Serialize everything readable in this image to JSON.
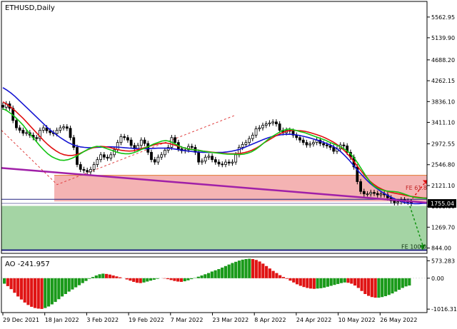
{
  "symbol_label": "ETHUSD,Daily",
  "indicator_label": "AO -241.957",
  "colors": {
    "bg": "#ffffff",
    "frame": "#000000",
    "candle": "#000000",
    "ma_fast": "#12c412",
    "ma_mid": "#e01010",
    "ma_slow": "#1414d2",
    "trendline": "#a020a8",
    "zone_red": "#f4b3b3",
    "zone_green": "#a4d4a4",
    "zone_red_line": "#e07830",
    "ao_up": "#1a9a1a",
    "ao_down": "#e01414",
    "price_box": "#000000",
    "level_line": "#202080"
  },
  "fib_labels": {
    "fe618": "FE 61.8",
    "fe100": "FE 100.0"
  },
  "chart_data": [
    {
      "type": "candlestick",
      "title": "ETHUSD,Daily",
      "x_ticks": [
        "29 Dec 2021",
        "18 Jan 2022",
        "3 Feb 2022",
        "19 Feb 2022",
        "7 Mar 2022",
        "23 Mar 2022",
        "8 Apr 2022",
        "24 Apr 2022",
        "10 May 2022",
        "26 May 2022"
      ],
      "y_ticks": [
        "5562.95",
        "5139.90",
        "4688.20",
        "4262.15",
        "3836.10",
        "3411.10",
        "2972.55",
        "2546.80",
        "2121.10",
        "1695.00",
        "1269.70",
        "844.00"
      ],
      "ylim": [
        735,
        5882
      ],
      "current_price": "1755.04",
      "close": [
        3720,
        3790,
        3700,
        3450,
        3300,
        3250,
        3190,
        3200,
        3150,
        3100,
        3080,
        3250,
        3300,
        3240,
        3200,
        3180,
        3250,
        3300,
        3320,
        3290,
        3100,
        2900,
        2550,
        2450,
        2430,
        2400,
        2450,
        2550,
        2650,
        2750,
        2700,
        2680,
        2750,
        2850,
        3000,
        3120,
        3100,
        3050,
        2940,
        2870,
        2940,
        3050,
        2980,
        2800,
        2650,
        2600,
        2700,
        2750,
        2840,
        2900,
        3100,
        3000,
        2870,
        2830,
        2850,
        2920,
        2900,
        2800,
        2600,
        2620,
        2700,
        2720,
        2650,
        2600,
        2560,
        2550,
        2600,
        2580,
        2600,
        2750,
        2900,
        2960,
        3000,
        3080,
        3150,
        3280,
        3300,
        3350,
        3380,
        3400,
        3420,
        3380,
        3250,
        3200,
        3250,
        3230,
        3150,
        3100,
        3050,
        3000,
        2950,
        2970,
        3000,
        3050,
        2980,
        2950,
        2930,
        2900,
        2820,
        2870,
        2950,
        2930,
        2800,
        2700,
        2500,
        2200,
        2000,
        1950,
        1950,
        1980,
        1960,
        1930,
        1950,
        1930,
        1870,
        1810,
        1770,
        1790,
        1830,
        1800,
        1780,
        1755
      ],
      "ma_fast": [
        3690,
        3650,
        3590,
        3520,
        3440,
        3350,
        3240,
        3140,
        3040,
        2940,
        2850,
        2770,
        2710,
        2670,
        2640,
        2635,
        2650,
        2680,
        2720,
        2770,
        2820,
        2865,
        2900,
        2920,
        2915,
        2890,
        2860,
        2830,
        2800,
        2780,
        2770,
        2770,
        2790,
        2820,
        2860,
        2890,
        2930,
        2970,
        3000,
        3030,
        3040,
        3020,
        2980,
        2940,
        2900,
        2880,
        2860,
        2850,
        2840,
        2825,
        2810,
        2800,
        2790,
        2780,
        2770,
        2762,
        2760,
        2760,
        2755,
        2760,
        2780,
        2810,
        2860,
        2920,
        2990,
        3060,
        3120,
        3170,
        3220,
        3255,
        3275,
        3265,
        3245,
        3220,
        3200,
        3170,
        3140,
        3110,
        3080,
        3050,
        3010,
        2975,
        2940,
        2905,
        2850,
        2790,
        2700,
        2580,
        2450,
        2320,
        2200,
        2110,
        2060,
        2030,
        2010,
        2000,
        1995,
        1985,
        1960,
        1930,
        1900,
        1880,
        1870,
        1865,
        1860
      ],
      "ma_mid": [
        3830,
        3780,
        3720,
        3650,
        3570,
        3490,
        3400,
        3310,
        3220,
        3130,
        3040,
        2960,
        2890,
        2830,
        2780,
        2750,
        2735,
        2735,
        2750,
        2780,
        2820,
        2860,
        2890,
        2910,
        2920,
        2915,
        2900,
        2880,
        2860,
        2840,
        2830,
        2825,
        2830,
        2850,
        2875,
        2900,
        2925,
        2950,
        2970,
        2985,
        2990,
        2975,
        2950,
        2925,
        2900,
        2880,
        2865,
        2850,
        2840,
        2825,
        2815,
        2805,
        2795,
        2785,
        2778,
        2772,
        2770,
        2770,
        2775,
        2790,
        2810,
        2840,
        2880,
        2930,
        2990,
        3040,
        3090,
        3140,
        3180,
        3215,
        3240,
        3250,
        3245,
        3240,
        3230,
        3210,
        3185,
        3160,
        3130,
        3095,
        3055,
        3010,
        2955,
        2890,
        2810,
        2720,
        2620,
        2510,
        2400,
        2300,
        2210,
        2140,
        2085,
        2045,
        2010,
        1985,
        1965,
        1950,
        1935,
        1915,
        1900,
        1890,
        1880,
        1870,
        1865
      ],
      "ma_slow": [
        4120,
        4070,
        4010,
        3940,
        3860,
        3780,
        3700,
        3620,
        3540,
        3460,
        3380,
        3300,
        3230,
        3165,
        3105,
        3050,
        3000,
        2960,
        2930,
        2910,
        2900,
        2895,
        2895,
        2900,
        2905,
        2910,
        2912,
        2910,
        2905,
        2900,
        2892,
        2885,
        2880,
        2876,
        2874,
        2874,
        2876,
        2880,
        2884,
        2886,
        2884,
        2878,
        2868,
        2855,
        2840,
        2828,
        2818,
        2810,
        2804,
        2800,
        2798,
        2796,
        2795,
        2796,
        2800,
        2808,
        2820,
        2838,
        2860,
        2890,
        2925,
        2960,
        2995,
        3030,
        3065,
        3095,
        3120,
        3140,
        3155,
        3165,
        3168,
        3165,
        3155,
        3140,
        3120,
        3100,
        3075,
        3050,
        3022,
        2990,
        2960,
        2920,
        2870,
        2800,
        2720,
        2630,
        2530,
        2430,
        2340,
        2250,
        2170,
        2100,
        2040,
        1985,
        1935,
        1890,
        1850,
        1815,
        1785,
        1765,
        1755,
        1750,
        1750,
        1755,
        1755
      ]
    },
    {
      "type": "bar",
      "title": "AO -241.957",
      "y_ticks": [
        "573.283",
        "0.00",
        "-1016.319"
      ],
      "ylim": [
        -1130,
        700
      ],
      "values": [
        -180,
        -260,
        -360,
        -480,
        -600,
        -700,
        -800,
        -880,
        -940,
        -980,
        -1000,
        -1010,
        -980,
        -930,
        -860,
        -780,
        -690,
        -600,
        -520,
        -440,
        -370,
        -300,
        -230,
        -160,
        -90,
        -20,
        40,
        90,
        130,
        150,
        140,
        120,
        90,
        60,
        30,
        0,
        -40,
        -80,
        -120,
        -150,
        -160,
        -140,
        -110,
        -80,
        -50,
        -20,
        0,
        -10,
        -30,
        -60,
        -90,
        -110,
        -120,
        -100,
        -70,
        -30,
        10,
        50,
        90,
        130,
        170,
        220,
        260,
        300,
        350,
        400,
        450,
        500,
        540,
        580,
        610,
        630,
        640,
        630,
        600,
        550,
        480,
        400,
        320,
        240,
        170,
        100,
        40,
        -20,
        -80,
        -140,
        -200,
        -250,
        -290,
        -320,
        -340,
        -350,
        -340,
        -330,
        -310,
        -280,
        -250,
        -220,
        -190,
        -160,
        -140,
        -150,
        -180,
        -240,
        -320,
        -420,
        -520,
        -580,
        -620,
        -640,
        -640,
        -620,
        -590,
        -550,
        -500,
        -440,
        -380,
        -320,
        -270,
        -240
      ]
    }
  ]
}
